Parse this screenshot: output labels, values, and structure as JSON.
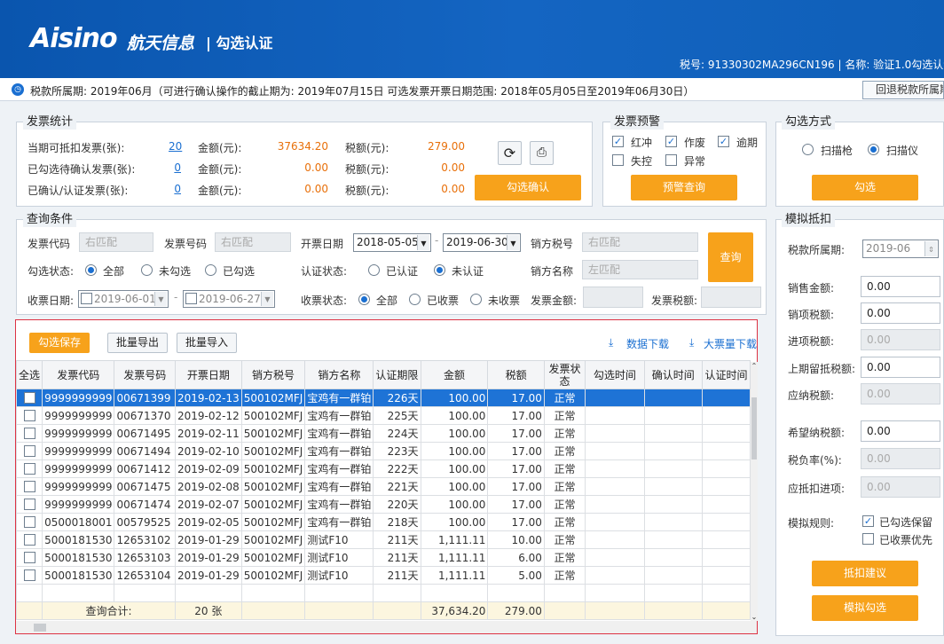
{
  "header": {
    "logo": "Aisino",
    "logo_cn": "航天信息",
    "module": "| 勾选认证",
    "tax_info": "税号: 91330302MA296CN196 | 名称: 验证1.0勾选认证"
  },
  "infobar": {
    "clock_icon": "clock-icon",
    "text": "税款所属期: 2019年06月（可进行确认操作的截止期为: 2019年07月15日 可选发票开票日期范围: 2018年05月05日至2019年06月30日）",
    "rollback": "回退税款所属期"
  },
  "stats": {
    "legend": "发票统计",
    "rows": [
      {
        "label": "当期可抵扣发票(张):",
        "count": "20",
        "amt_label": "金额(元):",
        "amt": "37634.20",
        "tax_label": "税额(元):",
        "tax": "279.00"
      },
      {
        "label": "已勾选待确认发票(张):",
        "count": "0",
        "amt_label": "金额(元):",
        "amt": "0.00",
        "tax_label": "税额(元):",
        "tax": "0.00"
      },
      {
        "label": "已确认/认证发票(张):",
        "count": "0",
        "amt_label": "金额(元):",
        "amt": "0.00",
        "tax_label": "税额(元):",
        "tax": "0.00"
      }
    ],
    "confirm": "勾选确认"
  },
  "warning": {
    "legend": "发票预警",
    "checks": [
      {
        "label": "红冲",
        "on": true
      },
      {
        "label": "作废",
        "on": true
      },
      {
        "label": "逾期",
        "on": true
      },
      {
        "label": "失控",
        "on": false
      },
      {
        "label": "异常",
        "on": false
      }
    ],
    "btn": "预警查询"
  },
  "method": {
    "legend": "勾选方式",
    "opt1": "扫描枪",
    "opt2": "扫描仪",
    "btn": "勾选"
  },
  "query": {
    "legend": "查询条件",
    "code_label": "发票代码",
    "code_ph": "右匹配",
    "num_label": "发票号码",
    "num_ph": "右匹配",
    "date_label": "开票日期",
    "date_from": "2018-05-05",
    "date_to": "2019-06-30",
    "seller_tax_label": "销方税号",
    "seller_tax_ph": "右匹配",
    "state_label": "勾选状态:",
    "state_opts": [
      "全部",
      "未勾选",
      "已勾选"
    ],
    "auth_label": "认证状态:",
    "auth_opts": [
      "已认证",
      "未认证"
    ],
    "seller_name_label": "销方名称",
    "seller_name_ph": "左匹配",
    "recv_label": "收票日期:",
    "recv_from": "2019-06-01",
    "recv_to": "2019-06-27",
    "recv_state_label": "收票状态:",
    "recv_opts": [
      "全部",
      "已收票",
      "未收票"
    ],
    "inv_amt_label": "发票金额:",
    "inv_tax_label": "发票税额:",
    "search": "查询"
  },
  "toolbar": {
    "save": "勾选保存",
    "export": "批量导出",
    "import": "批量导入",
    "download": "数据下载",
    "bigdownload": "大票量下载"
  },
  "grid": {
    "headers": [
      "全选",
      "发票代码",
      "发票号码",
      "开票日期",
      "销方税号",
      "销方名称",
      "认证期限",
      "金额",
      "税额",
      "发票状态",
      "勾选时间",
      "确认时间",
      "认证时间"
    ],
    "rows": [
      [
        "9999999999",
        "00671399",
        "2019-02-13",
        "500102MFJ",
        "宝鸡有一群铂",
        "226天",
        "100.00",
        "17.00",
        "正常"
      ],
      [
        "9999999999",
        "00671370",
        "2019-02-12",
        "500102MFJ",
        "宝鸡有一群铂",
        "225天",
        "100.00",
        "17.00",
        "正常"
      ],
      [
        "9999999999",
        "00671495",
        "2019-02-11",
        "500102MFJ",
        "宝鸡有一群铂",
        "224天",
        "100.00",
        "17.00",
        "正常"
      ],
      [
        "9999999999",
        "00671494",
        "2019-02-10",
        "500102MFJ",
        "宝鸡有一群铂",
        "223天",
        "100.00",
        "17.00",
        "正常"
      ],
      [
        "9999999999",
        "00671412",
        "2019-02-09",
        "500102MFJ",
        "宝鸡有一群铂",
        "222天",
        "100.00",
        "17.00",
        "正常"
      ],
      [
        "9999999999",
        "00671475",
        "2019-02-08",
        "500102MFJ",
        "宝鸡有一群铂",
        "221天",
        "100.00",
        "17.00",
        "正常"
      ],
      [
        "9999999999",
        "00671474",
        "2019-02-07",
        "500102MFJ",
        "宝鸡有一群铂",
        "220天",
        "100.00",
        "17.00",
        "正常"
      ],
      [
        "0500018001",
        "00579525",
        "2019-02-05",
        "500102MFJ",
        "宝鸡有一群铂",
        "218天",
        "100.00",
        "17.00",
        "正常"
      ],
      [
        "5000181530",
        "12653102",
        "2019-01-29",
        "500102MFJ",
        "测试F10",
        "211天",
        "1,111.11",
        "10.00",
        "正常"
      ],
      [
        "5000181530",
        "12653103",
        "2019-01-29",
        "500102MFJ",
        "测试F10",
        "211天",
        "1,111.11",
        "6.00",
        "正常"
      ],
      [
        "5000181530",
        "12653104",
        "2019-01-29",
        "500102MFJ",
        "测试F10",
        "211天",
        "1,111.11",
        "5.00",
        "正常"
      ]
    ],
    "total": {
      "label": "查询合计:",
      "count": "20 张",
      "amount": "37,634.20",
      "tax": "279.00"
    }
  },
  "sim": {
    "legend": "模拟抵扣",
    "period_label": "税款所属期:",
    "period": "2019-06",
    "fields": [
      {
        "label": "销售金额:",
        "value": "0.00",
        "enabled": true
      },
      {
        "label": "销项税额:",
        "value": "0.00",
        "enabled": true
      },
      {
        "label": "进项税额:",
        "value": "0.00",
        "enabled": false
      },
      {
        "label": "上期留抵税额:",
        "value": "0.00",
        "enabled": true
      },
      {
        "label": "应纳税额:",
        "value": "0.00",
        "enabled": false
      },
      {
        "label": "希望纳税额:",
        "value": "0.00",
        "enabled": true
      },
      {
        "label": "税负率(%):",
        "value": "0.00",
        "enabled": false
      },
      {
        "label": "应抵扣进项:",
        "value": "0.00",
        "enabled": false
      }
    ],
    "rule_label": "模拟规则:",
    "rule1": "已勾选保留",
    "rule2": "已收票优先",
    "btn1": "抵扣建议",
    "btn2": "模拟勾选"
  }
}
